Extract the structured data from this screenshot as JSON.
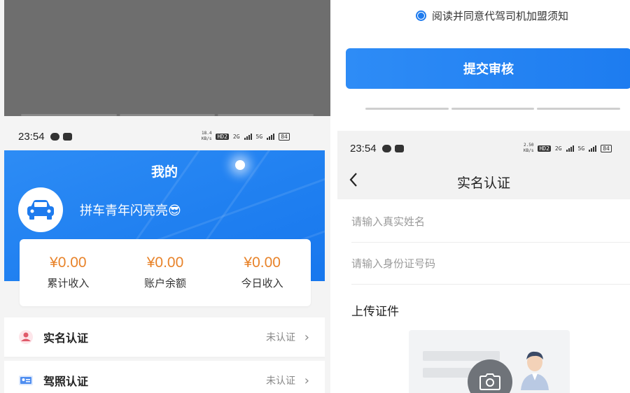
{
  "left_screen": {
    "status_bar": {
      "time": "23:54",
      "net_speed": "18.4\nKB/s",
      "hd": "HD2",
      "sig1": "2G",
      "sig2": "5G",
      "battery": "84"
    },
    "header": {
      "title": "我的",
      "nickname": "拼车青年闪亮亮😎"
    },
    "stats": [
      {
        "value": "¥0.00",
        "label": "累计收入"
      },
      {
        "value": "¥0.00",
        "label": "账户余额"
      },
      {
        "value": "¥0.00",
        "label": "今日收入"
      }
    ],
    "menu": [
      {
        "label": "实名认证",
        "status": "未认证"
      },
      {
        "label": "驾照认证",
        "status": "未认证"
      }
    ]
  },
  "right_screen": {
    "agreement_text": "阅读并同意代驾司机加盟须知",
    "submit_label": "提交审核",
    "status_bar": {
      "time": "23:54",
      "net_speed": "2.50\nKB/s",
      "hd": "HD2",
      "sig1": "2G",
      "sig2": "5G",
      "battery": "84"
    },
    "nav_title": "实名认证",
    "name_placeholder": "请输入真实姓名",
    "id_placeholder": "请输入身份证号码",
    "upload_title": "上传证件"
  },
  "colors": {
    "primary": "#1e7bee",
    "amount": "#e8832a",
    "icon_red": "#e05a6a"
  }
}
